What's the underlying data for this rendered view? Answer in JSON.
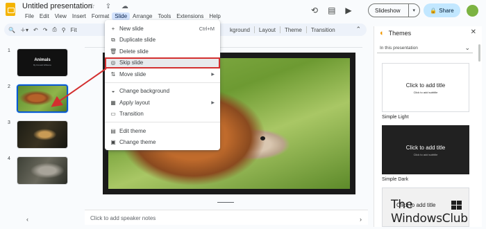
{
  "app": {
    "title": "Untitled presentation",
    "title_icons": "☆ ⇪ ☁"
  },
  "menubar": {
    "items": [
      {
        "label": "File"
      },
      {
        "label": "Edit"
      },
      {
        "label": "View"
      },
      {
        "label": "Insert"
      },
      {
        "label": "Format"
      },
      {
        "label": "Slide"
      },
      {
        "label": "Arrange"
      },
      {
        "label": "Tools"
      },
      {
        "label": "Extensions"
      },
      {
        "label": "Help"
      }
    ],
    "active": "Slide"
  },
  "header": {
    "slideshow_label": "Slideshow",
    "share_label": "Share"
  },
  "toolbar": {
    "fit_label": "Fit",
    "background_label": "kground",
    "layout_label": "Layout",
    "theme_label": "Theme",
    "transition_label": "Transition"
  },
  "filmstrip": {
    "slides": [
      {
        "number": "1",
        "title": "Animals",
        "subtitle": "By Donald Williams"
      },
      {
        "number": "2"
      },
      {
        "number": "3"
      },
      {
        "number": "4"
      }
    ],
    "selected": "2"
  },
  "slide_menu": {
    "items": [
      {
        "icon": "+",
        "label": "New slide",
        "shortcut": "Ctrl+M"
      },
      {
        "icon": "⧉",
        "label": "Duplicate slide"
      },
      {
        "icon": "🗑",
        "label": "Delete slide"
      },
      {
        "icon": "◎",
        "label": "Skip slide",
        "highlighted": true
      },
      {
        "icon": "⇅",
        "label": "Move slide",
        "submenu": true
      },
      {
        "icon": "◒",
        "label": "Change background"
      },
      {
        "icon": "▦",
        "label": "Apply layout",
        "submenu": true
      },
      {
        "icon": "▭",
        "label": "Transition"
      },
      {
        "icon": "▤",
        "label": "Edit theme"
      },
      {
        "icon": "▣",
        "label": "Change theme"
      }
    ]
  },
  "notes": {
    "placeholder": "Click to add speaker notes"
  },
  "themes_panel": {
    "title": "Themes",
    "filter": "In this presentation",
    "themes": [
      {
        "name": "Simple Light",
        "card_title": "Click to add title",
        "card_subtitle": "Click to add subtitle",
        "bg": "#ffffff",
        "fg": "#1f1f1f"
      },
      {
        "name": "Simple Dark",
        "card_title": "Click to add title",
        "card_subtitle": "Click to add subtitle",
        "bg": "#212121",
        "fg": "#ffffff"
      },
      {
        "card_title": "Click to add title",
        "bg": "#f1f1f1",
        "fg": "#1f1f1f"
      }
    ]
  },
  "watermark": {
    "line1": "The",
    "line2": "WindowsClub"
  },
  "colors": {
    "accent": "#0b57d0",
    "share_bg": "#c2e7ff",
    "annotation": "#d32f2f",
    "active_menu": "#d3e3fd"
  }
}
